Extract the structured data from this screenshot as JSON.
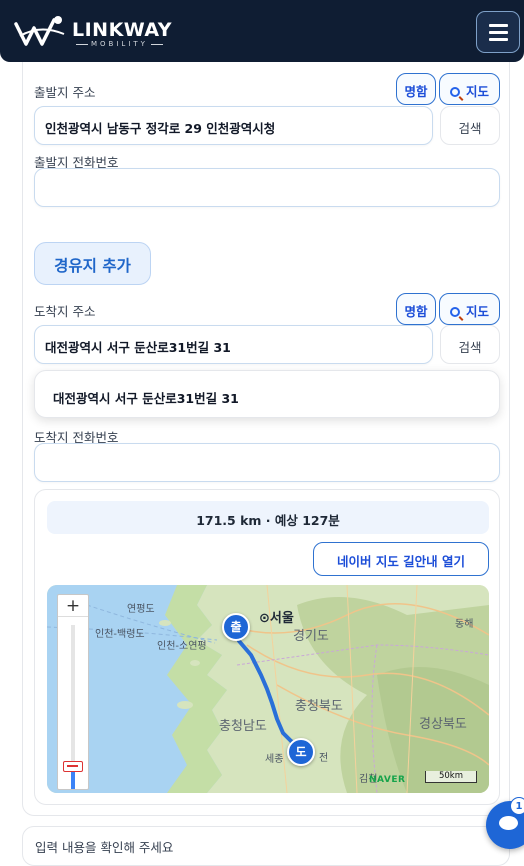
{
  "header": {
    "brand_name": "LINKWAY",
    "brand_sub": "MOBILITY",
    "menu_icon": "hamburger-icon"
  },
  "origin": {
    "address_label": "출발지 주소",
    "business_card_button": "명함",
    "map_button": "지도",
    "address_value": "인천광역시 남동구 정각로 29 인천광역시청",
    "search_button": "검색",
    "phone_label": "출발지 전화번호",
    "phone_value": ""
  },
  "waypoint": {
    "add_button": "경유지 추가"
  },
  "destination": {
    "address_label": "도착지 주소",
    "business_card_button": "명함",
    "map_button": "지도",
    "address_value": "대전광역시 서구 둔산로31번길 31",
    "search_button": "검색",
    "suggestion": "대전광역시 서구 둔산로31번길 31",
    "phone_label": "도착지 전화번호",
    "phone_value": ""
  },
  "route": {
    "summary": "171.5 km · 예상 127분",
    "naver_button": "네이버 지도 길안내 열기",
    "map": {
      "zoom_in": "+",
      "start_marker": "출",
      "end_marker": "도",
      "labels": {
        "yeonpyeong": "연평도",
        "seoul": "서울",
        "incheon_baengnyeong": "인천-백령도",
        "incheon_socheong": "인천-소연평",
        "gyeonggi": "경기도",
        "donghae": "동해",
        "chungbuk": "충청북도",
        "chungnam": "충청남도",
        "gyeongbuk": "경상북도",
        "sejong": "세종",
        "daejeon_suffix": "전",
        "gimcheon": "김천"
      },
      "attribution": "NAVER",
      "scale": "50km",
      "route_color": "#2a6fd8"
    }
  },
  "footer": {
    "notice": "입력 내용을 확인해 주세요",
    "chat_badge": "1"
  }
}
